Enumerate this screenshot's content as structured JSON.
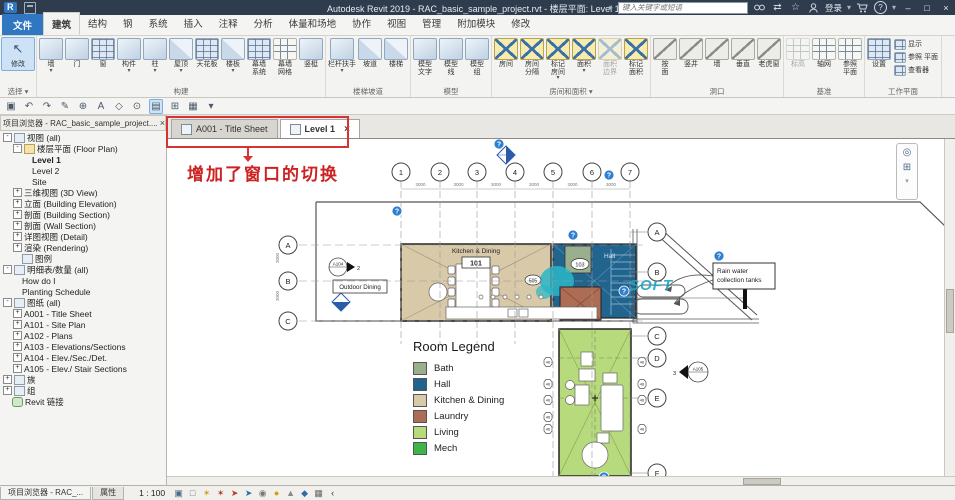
{
  "title_bar": {
    "title": "Autodesk Revit 2019 - RAC_basic_sample_project.rvt - 楼层平面: Level 1",
    "search_placeholder": "键入关键字或短语",
    "login": "登录",
    "exchange_icon": "⇄",
    "star_icon": "☆",
    "help_icon": "?",
    "caret": "▾",
    "minimize": "–",
    "restore": "□",
    "close": "×"
  },
  "ribbon": {
    "file_tab": "文件",
    "active_tab": "建筑",
    "tabs": [
      "建筑",
      "结构",
      "钢",
      "系统",
      "插入",
      "注释",
      "分析",
      "体量和场地",
      "协作",
      "视图",
      "管理",
      "附加模块",
      "修改"
    ],
    "groups": [
      {
        "name": "选择 ▾",
        "buttons": [
          {
            "label": "修改",
            "icon": "modify-cursor-icon",
            "big": true
          }
        ]
      },
      {
        "name": "构建",
        "buttons": [
          {
            "label": "墙",
            "icon": "wall-icon",
            "caret": true
          },
          {
            "label": "门",
            "icon": "door-icon"
          },
          {
            "label": "窗",
            "icon": "window-icon"
          },
          {
            "label": "构件",
            "icon": "component-icon",
            "caret": true
          },
          {
            "label": "柱",
            "icon": "column-icon",
            "caret": true
          },
          {
            "label": "屋顶",
            "icon": "roof-icon",
            "caret": true
          },
          {
            "label": "天花板",
            "icon": "ceiling-icon"
          },
          {
            "label": "楼板",
            "icon": "floor-icon",
            "caret": true
          },
          {
            "label": "幕墙\n系统",
            "icon": "curtain-system-icon"
          },
          {
            "label": "幕墙\n网格",
            "icon": "curtain-grid-icon"
          },
          {
            "label": "竖梃",
            "icon": "mullion-icon"
          }
        ]
      },
      {
        "name": "楼梯坡道",
        "buttons": [
          {
            "label": "栏杆扶手",
            "icon": "railing-icon",
            "caret": true
          },
          {
            "label": "坡道",
            "icon": "ramp-icon"
          },
          {
            "label": "楼梯",
            "icon": "stair-icon"
          }
        ]
      },
      {
        "name": "模型",
        "buttons": [
          {
            "label": "模型\n文字",
            "icon": "model-text-icon"
          },
          {
            "label": "模型\n线",
            "icon": "model-line-icon"
          },
          {
            "label": "模型\n组",
            "icon": "model-group-icon"
          }
        ]
      },
      {
        "name": "房间和面积 ▾",
        "buttons": [
          {
            "label": "房间",
            "icon": "room-icon"
          },
          {
            "label": "房间\n分隔",
            "icon": "room-separator-icon"
          },
          {
            "label": "标记\n房间",
            "icon": "tag-room-icon",
            "caret": true
          },
          {
            "label": "面积",
            "icon": "area-icon",
            "caret": true
          },
          {
            "label": "面积\n边界",
            "icon": "area-boundary-icon",
            "disabled": true
          },
          {
            "label": "标记\n面积",
            "icon": "tag-area-icon"
          }
        ]
      },
      {
        "name": "洞口",
        "buttons": [
          {
            "label": "按\n面",
            "icon": "opening-by-face-icon"
          },
          {
            "label": "竖井",
            "icon": "shaft-icon"
          },
          {
            "label": "墙",
            "icon": "wall-opening-icon"
          },
          {
            "label": "垂直",
            "icon": "vertical-opening-icon"
          },
          {
            "label": "老虎窗",
            "icon": "dormer-icon"
          }
        ]
      },
      {
        "name": "基准",
        "buttons": [
          {
            "label": "标高",
            "icon": "level-icon",
            "disabled": true
          },
          {
            "label": "轴网",
            "icon": "grid-icon"
          },
          {
            "label": "参照\n平面",
            "icon": "ref-plane-icon"
          }
        ]
      },
      {
        "name": "工作平面",
        "buttons": [
          {
            "label": "设置",
            "icon": "set-workplane-icon"
          }
        ],
        "small_buttons": [
          {
            "label": "显示",
            "icon": "show-workplane-icon"
          },
          {
            "label": "参照 平面",
            "icon": "ref-plane-small-icon"
          },
          {
            "label": "查看器",
            "icon": "viewer-icon"
          }
        ]
      }
    ]
  },
  "qat": [
    {
      "name": "save-icon",
      "glyph": "▣"
    },
    {
      "name": "undo-icon",
      "glyph": "↶"
    },
    {
      "name": "redo-icon",
      "glyph": "↷"
    },
    {
      "name": "print-icon",
      "glyph": "✎"
    },
    {
      "name": "measure-icon",
      "glyph": "⊕"
    },
    {
      "name": "text-icon",
      "glyph": "A"
    },
    {
      "name": "3d-view-icon",
      "glyph": "◇"
    },
    {
      "name": "section-icon",
      "glyph": "⊙"
    },
    {
      "name": "thin-lines-icon",
      "glyph": "▤",
      "hl": true
    },
    {
      "name": "switch-windows-icon",
      "glyph": "⊞"
    },
    {
      "name": "close-inactive-icon",
      "glyph": "▦"
    },
    {
      "name": "customize-qat-icon",
      "glyph": "▾"
    }
  ],
  "project_browser": {
    "title": "项目浏览器 - RAC_basic_sample_project....",
    "close": "×",
    "tree": [
      {
        "label": "视图 (all)",
        "depth": 0,
        "exp": "-",
        "icon": "views"
      },
      {
        "label": "楼层平面 (Floor Plan)",
        "depth": 1,
        "exp": "-",
        "icon": "folder"
      },
      {
        "label": "Level 1",
        "depth": 2,
        "sel": true
      },
      {
        "label": "Level 2",
        "depth": 2
      },
      {
        "label": "Site",
        "depth": 2
      },
      {
        "label": "三维视图 (3D View)",
        "depth": 1,
        "exp": "+"
      },
      {
        "label": "立面 (Building Elevation)",
        "depth": 1,
        "exp": "+"
      },
      {
        "label": "剖面 (Building Section)",
        "depth": 1,
        "exp": "+"
      },
      {
        "label": "剖面 (Wall Section)",
        "depth": 1,
        "exp": "+"
      },
      {
        "label": "详图视图 (Detail)",
        "depth": 1,
        "exp": "+"
      },
      {
        "label": "渲染 (Rendering)",
        "depth": 1,
        "exp": "+"
      },
      {
        "label": "图例",
        "depth": 1,
        "icon": "legend"
      },
      {
        "label": "明细表/数量 (all)",
        "depth": 0,
        "exp": "-",
        "icon": "schedule"
      },
      {
        "label": "How do I",
        "depth": 1
      },
      {
        "label": "Planting Schedule",
        "depth": 1
      },
      {
        "label": "图纸 (all)",
        "depth": 0,
        "exp": "-",
        "icon": "sheet"
      },
      {
        "label": "A001 - Title Sheet",
        "depth": 1,
        "exp": "+"
      },
      {
        "label": "A101 - Site Plan",
        "depth": 1,
        "exp": "+"
      },
      {
        "label": "A102 - Plans",
        "depth": 1,
        "exp": "+"
      },
      {
        "label": "A103 - Elevations/Sections",
        "depth": 1,
        "exp": "+"
      },
      {
        "label": "A104 - Elev./Sec./Det.",
        "depth": 1,
        "exp": "+"
      },
      {
        "label": "A105 - Elev./ Stair Sections",
        "depth": 1,
        "exp": "+"
      },
      {
        "label": "族",
        "depth": 0,
        "exp": "+",
        "icon": "family"
      },
      {
        "label": "组",
        "depth": 0,
        "exp": "+",
        "icon": "group"
      },
      {
        "label": "Revit 链接",
        "depth": 0,
        "icon": "link"
      }
    ]
  },
  "view_tabs": [
    {
      "label": "A001 - Title Sheet",
      "active": false
    },
    {
      "label": "Level 1",
      "active": true,
      "close": "×"
    }
  ],
  "annotation": {
    "label": "增加了窗口的切换",
    "color": "#cc2222"
  },
  "plan": {
    "grid_cols": [
      "1",
      "2",
      "3",
      "4",
      "5",
      "6",
      "7"
    ],
    "rows_left": [
      "A",
      "B",
      "C"
    ],
    "rows_right": [
      "A",
      "B",
      "C",
      "D",
      "E",
      "F"
    ],
    "dim_label": "3000",
    "kitchen_label": "Kitchen & Dining",
    "kitchen_tag": "101",
    "hall_label": "Hall",
    "hall_tag": "103",
    "door_tag": "505",
    "outdoor_label": "Outdoor Dining",
    "callout_line1": "Rain water",
    "callout_line2": "collection tanks",
    "ref1": "A104",
    "ref1_num": "2",
    "ref2": "A105",
    "ref2_num": "3",
    "window_tag": "46",
    "question_marker": "?",
    "watermark": "SOFT"
  },
  "legend": {
    "title": "Room Legend",
    "items": [
      {
        "name": "Bath",
        "color": "#9aaf8e"
      },
      {
        "name": "Hall",
        "color": "#21658f"
      },
      {
        "name": "Kitchen & Dining",
        "color": "#d8c9a8"
      },
      {
        "name": "Laundry",
        "color": "#ad6d55"
      },
      {
        "name": "Living",
        "color": "#b7da7d"
      },
      {
        "name": "Mech",
        "color": "#3db54a"
      }
    ]
  },
  "bottom": {
    "tabs": [
      "项目浏览器 - RAC_...",
      "属性"
    ],
    "scale": "1 : 100",
    "icons": [
      {
        "name": "visual-style-icon",
        "glyph": "▣",
        "color": "#4a6b8a"
      },
      {
        "name": "show-hidden-icon",
        "glyph": "□",
        "color": "#777777"
      },
      {
        "name": "sun-path-icon",
        "glyph": "✶",
        "color": "#d4a017"
      },
      {
        "name": "shadows-icon",
        "glyph": "✶",
        "color": "#c0392b"
      },
      {
        "name": "crop-view-icon",
        "glyph": "➤",
        "color": "#c0392b"
      },
      {
        "name": "crop-region-icon",
        "glyph": "➤",
        "color": "#2e6da4"
      },
      {
        "name": "temporary-hide-icon",
        "glyph": "◉",
        "color": "#777777"
      },
      {
        "name": "reveal-hidden-icon",
        "glyph": "●",
        "color": "#d4a017"
      },
      {
        "name": "constraints-icon",
        "glyph": "▲",
        "color": "#888888"
      },
      {
        "name": "camera-icon",
        "glyph": "◆",
        "color": "#2e6da4"
      },
      {
        "name": "analytical-icon",
        "glyph": "▦",
        "color": "#666666"
      },
      {
        "name": "collapse-icon",
        "glyph": "‹",
        "color": "#333333"
      }
    ]
  },
  "colors": {
    "accent_red": "#cc2222",
    "watermark": "#18a7c6"
  }
}
